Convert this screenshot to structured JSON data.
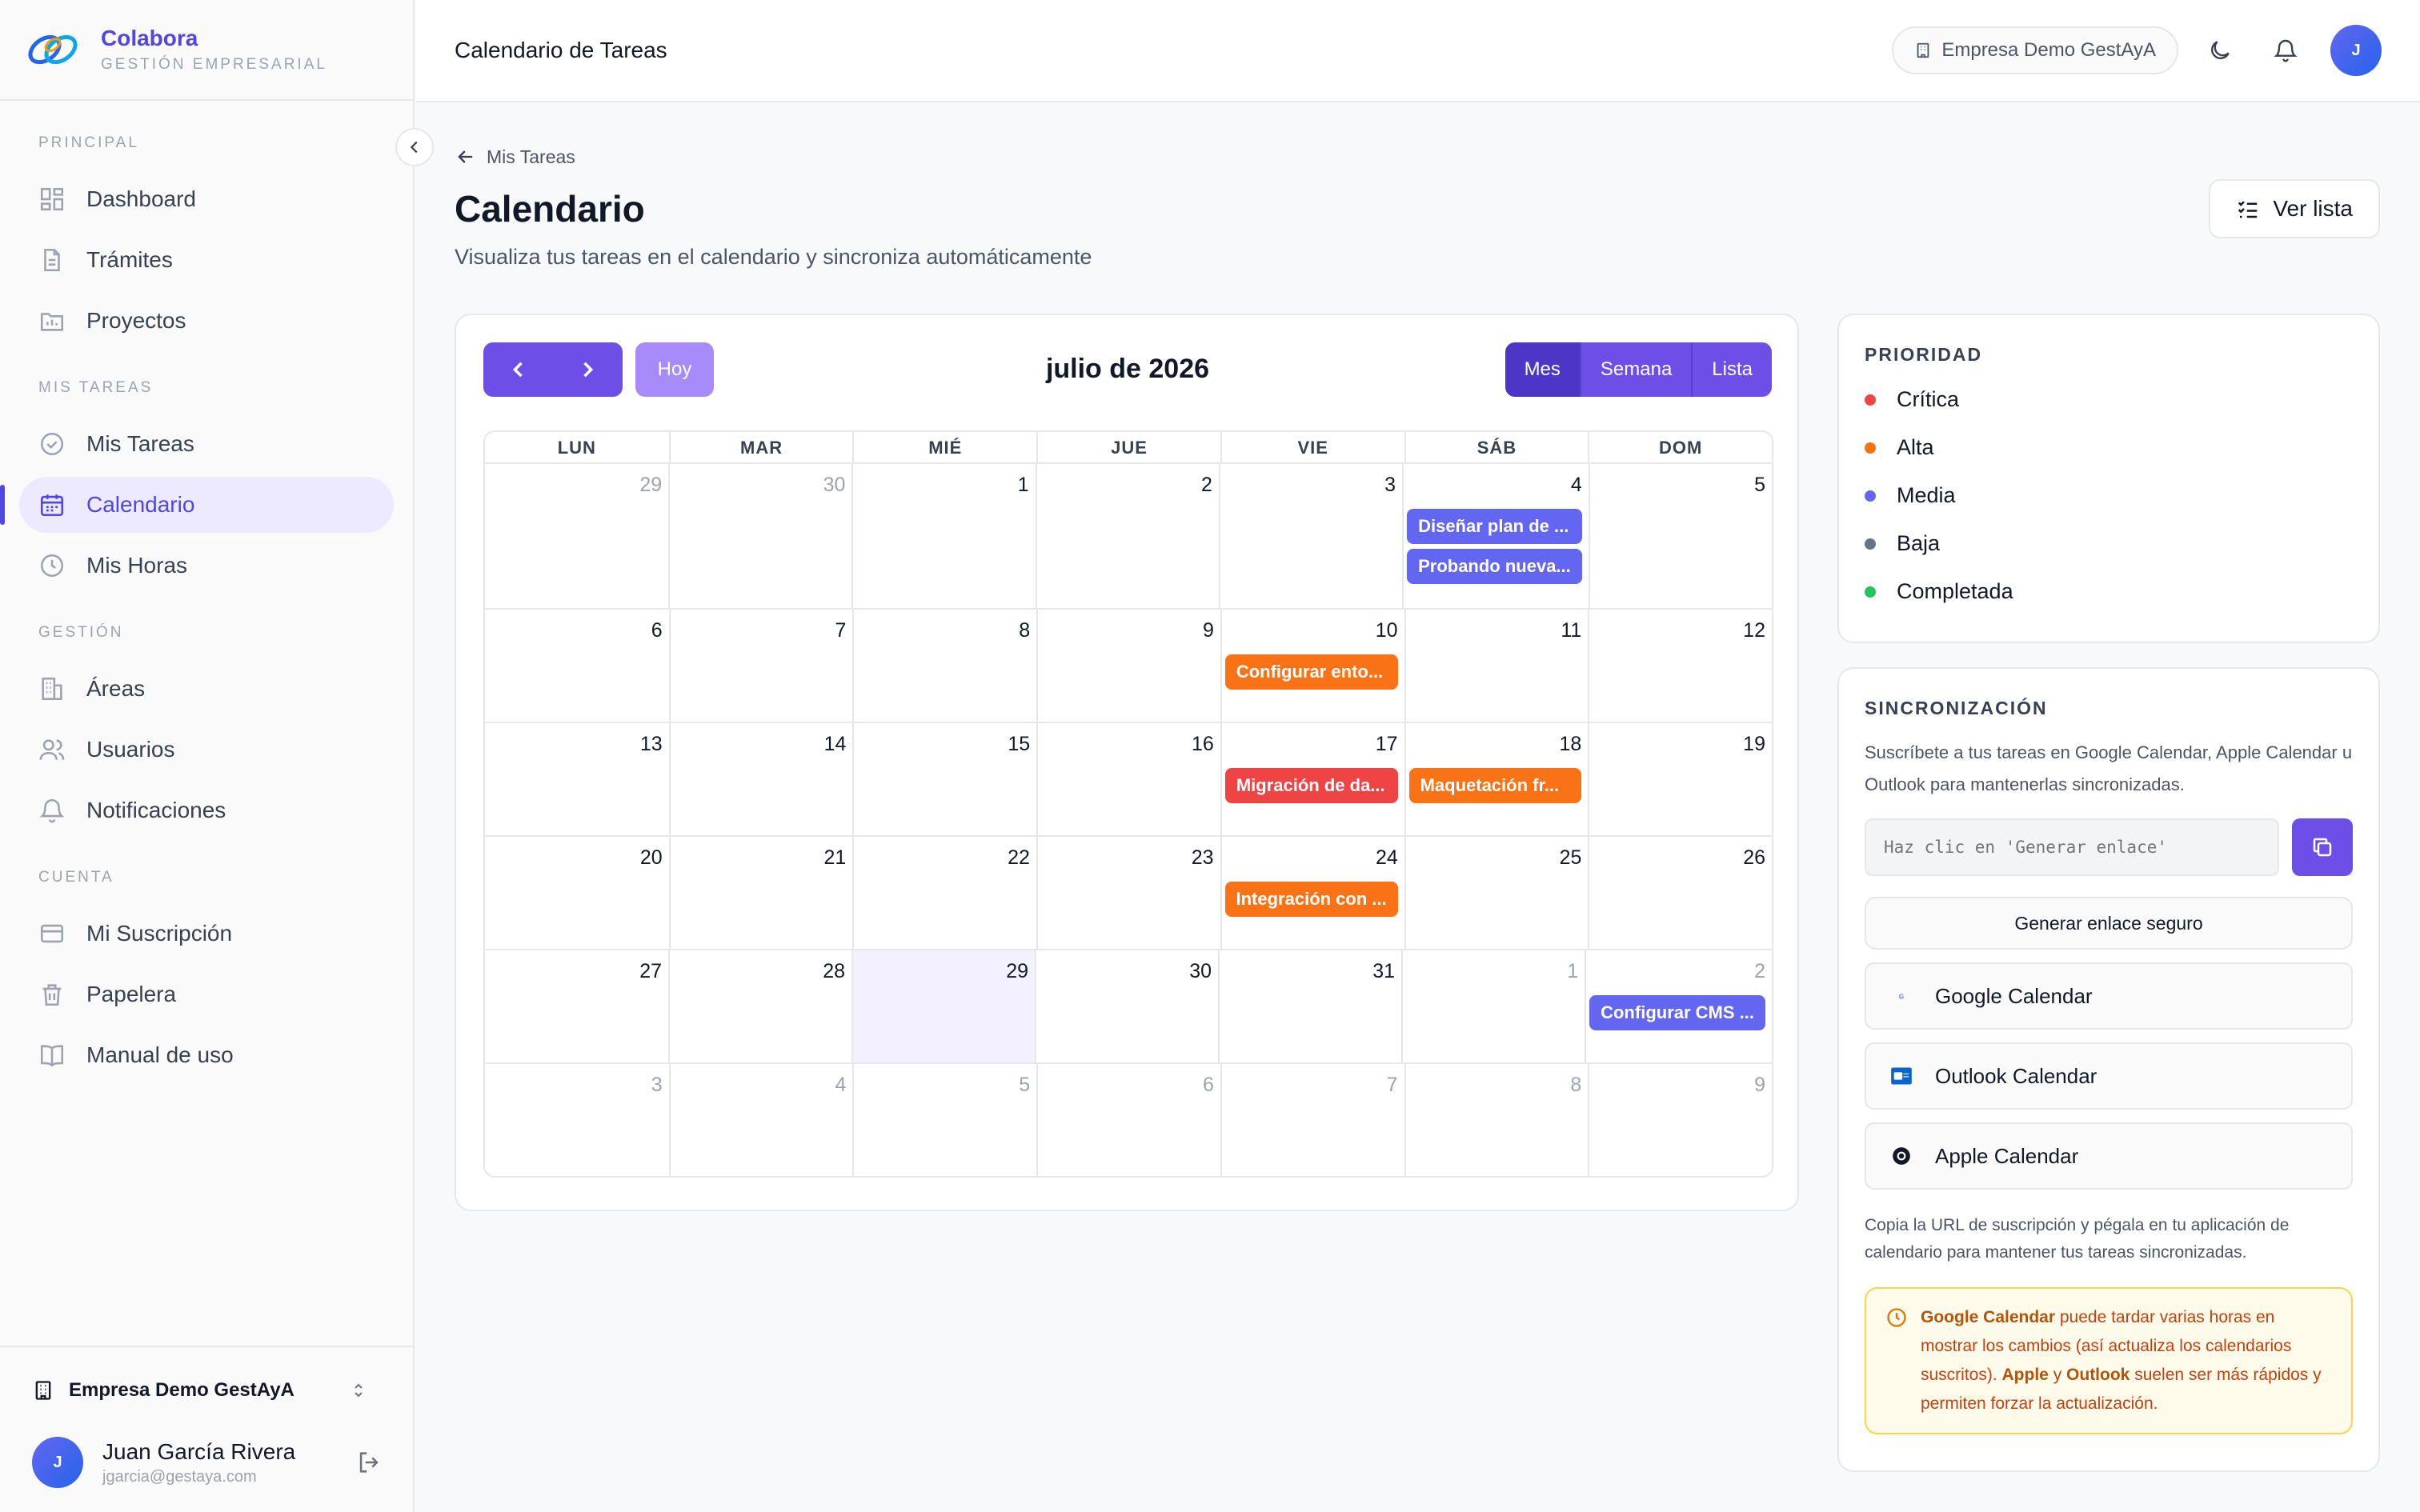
{
  "brand": {
    "name": "Colabora",
    "subtitle": "GESTIÓN EMPRESARIAL"
  },
  "sidebar": {
    "sections": [
      {
        "title": "PRINCIPAL",
        "items": [
          {
            "label": "Dashboard",
            "icon": "dashboard-icon"
          },
          {
            "label": "Trámites",
            "icon": "document-icon"
          },
          {
            "label": "Proyectos",
            "icon": "folder-icon"
          }
        ]
      },
      {
        "title": "MIS TAREAS",
        "items": [
          {
            "label": "Mis Tareas",
            "icon": "check-circle-icon"
          },
          {
            "label": "Calendario",
            "icon": "calendar-icon",
            "active": true
          },
          {
            "label": "Mis Horas",
            "icon": "clock-icon"
          }
        ]
      },
      {
        "title": "GESTIÓN",
        "items": [
          {
            "label": "Áreas",
            "icon": "building-icon"
          },
          {
            "label": "Usuarios",
            "icon": "users-icon"
          },
          {
            "label": "Notificaciones",
            "icon": "bell-icon"
          }
        ]
      },
      {
        "title": "CUENTA",
        "items": [
          {
            "label": "Mi Suscripción",
            "icon": "credit-card-icon"
          },
          {
            "label": "Papelera",
            "icon": "trash-icon"
          },
          {
            "label": "Manual de uso",
            "icon": "book-icon"
          }
        ]
      }
    ],
    "company": "Empresa Demo GestAyA",
    "user": {
      "initial": "J",
      "name": "Juan García Rivera",
      "email": "jgarcia@gestaya.com"
    }
  },
  "header": {
    "title": "Calendario de Tareas",
    "company": "Empresa Demo GestAyA",
    "avatar_initial": "J"
  },
  "page": {
    "back_label": "Mis Tareas",
    "title": "Calendario",
    "subtitle": "Visualiza tus tareas en el calendario y sincroniza automáticamente",
    "list_button": "Ver lista"
  },
  "calendar": {
    "today_label": "Hoy",
    "month_title": "julio de 2026",
    "views": [
      "Mes",
      "Semana",
      "Lista"
    ],
    "weekdays": [
      "LUN",
      "MAR",
      "MIÉ",
      "JUE",
      "VIE",
      "SÁB",
      "DOM"
    ],
    "weeks": [
      [
        {
          "n": "29",
          "muted": true
        },
        {
          "n": "30",
          "muted": true
        },
        {
          "n": "1"
        },
        {
          "n": "2"
        },
        {
          "n": "3"
        },
        {
          "n": "4",
          "events": [
            {
              "title": "Diseñar plan de ...",
              "color": "#6366f1"
            },
            {
              "title": "Probando nueva...",
              "color": "#6366f1"
            }
          ]
        },
        {
          "n": "5"
        }
      ],
      [
        {
          "n": "6"
        },
        {
          "n": "7"
        },
        {
          "n": "8"
        },
        {
          "n": "9"
        },
        {
          "n": "10",
          "events": [
            {
              "title": "Configurar ento...",
              "color": "#f97316"
            }
          ]
        },
        {
          "n": "11"
        },
        {
          "n": "12"
        }
      ],
      [
        {
          "n": "13"
        },
        {
          "n": "14"
        },
        {
          "n": "15"
        },
        {
          "n": "16"
        },
        {
          "n": "17",
          "events": [
            {
              "title": "Migración de da...",
              "color": "#ef4444"
            }
          ]
        },
        {
          "n": "18",
          "events": [
            {
              "title": "Maquetación fr...",
              "color": "#f97316"
            }
          ]
        },
        {
          "n": "19"
        }
      ],
      [
        {
          "n": "20"
        },
        {
          "n": "21"
        },
        {
          "n": "22"
        },
        {
          "n": "23"
        },
        {
          "n": "24",
          "events": [
            {
              "title": "Integración con ...",
              "color": "#f97316"
            }
          ]
        },
        {
          "n": "25"
        },
        {
          "n": "26"
        }
      ],
      [
        {
          "n": "27"
        },
        {
          "n": "28"
        },
        {
          "n": "29",
          "today": true
        },
        {
          "n": "30"
        },
        {
          "n": "31"
        },
        {
          "n": "1",
          "muted": true
        },
        {
          "n": "2",
          "muted": true,
          "events": [
            {
              "title": "Configurar CMS ...",
              "color": "#6366f1"
            }
          ]
        }
      ],
      [
        {
          "n": "3",
          "muted": true
        },
        {
          "n": "4",
          "muted": true
        },
        {
          "n": "5",
          "muted": true
        },
        {
          "n": "6",
          "muted": true
        },
        {
          "n": "7",
          "muted": true
        },
        {
          "n": "8",
          "muted": true
        },
        {
          "n": "9",
          "muted": true
        }
      ]
    ]
  },
  "priority": {
    "title": "PRIORIDAD",
    "items": [
      {
        "label": "Crítica",
        "color": "#ef4444"
      },
      {
        "label": "Alta",
        "color": "#f97316"
      },
      {
        "label": "Media",
        "color": "#6366f1"
      },
      {
        "label": "Baja",
        "color": "#64748b"
      },
      {
        "label": "Completada",
        "color": "#22c55e"
      }
    ]
  },
  "sync": {
    "title": "SINCRONIZACIÓN",
    "description": "Suscríbete a tus tareas en Google Calendar, Apple Calendar u Outlook para mantenerlas sincronizadas.",
    "input_placeholder": "Haz clic en 'Generar enlace'",
    "generate_label": "Generar enlace seguro",
    "providers": [
      {
        "label": "Google Calendar",
        "icon": "google-icon"
      },
      {
        "label": "Outlook Calendar",
        "icon": "outlook-icon"
      },
      {
        "label": "Apple Calendar",
        "icon": "apple-icon"
      }
    ],
    "note": "Copia la URL de suscripción y pégala en tu aplicación de calendario para mantener tus tareas sincronizadas.",
    "warning": {
      "bold1": "Google Calendar",
      "text1": " puede tardar varias horas en mostrar los cambios (así actualiza los calendarios suscritos). ",
      "bold2": "Apple",
      "text2": " y ",
      "bold3": "Outlook",
      "text3": " suelen ser más rápidos y permiten forzar la actualización."
    }
  }
}
